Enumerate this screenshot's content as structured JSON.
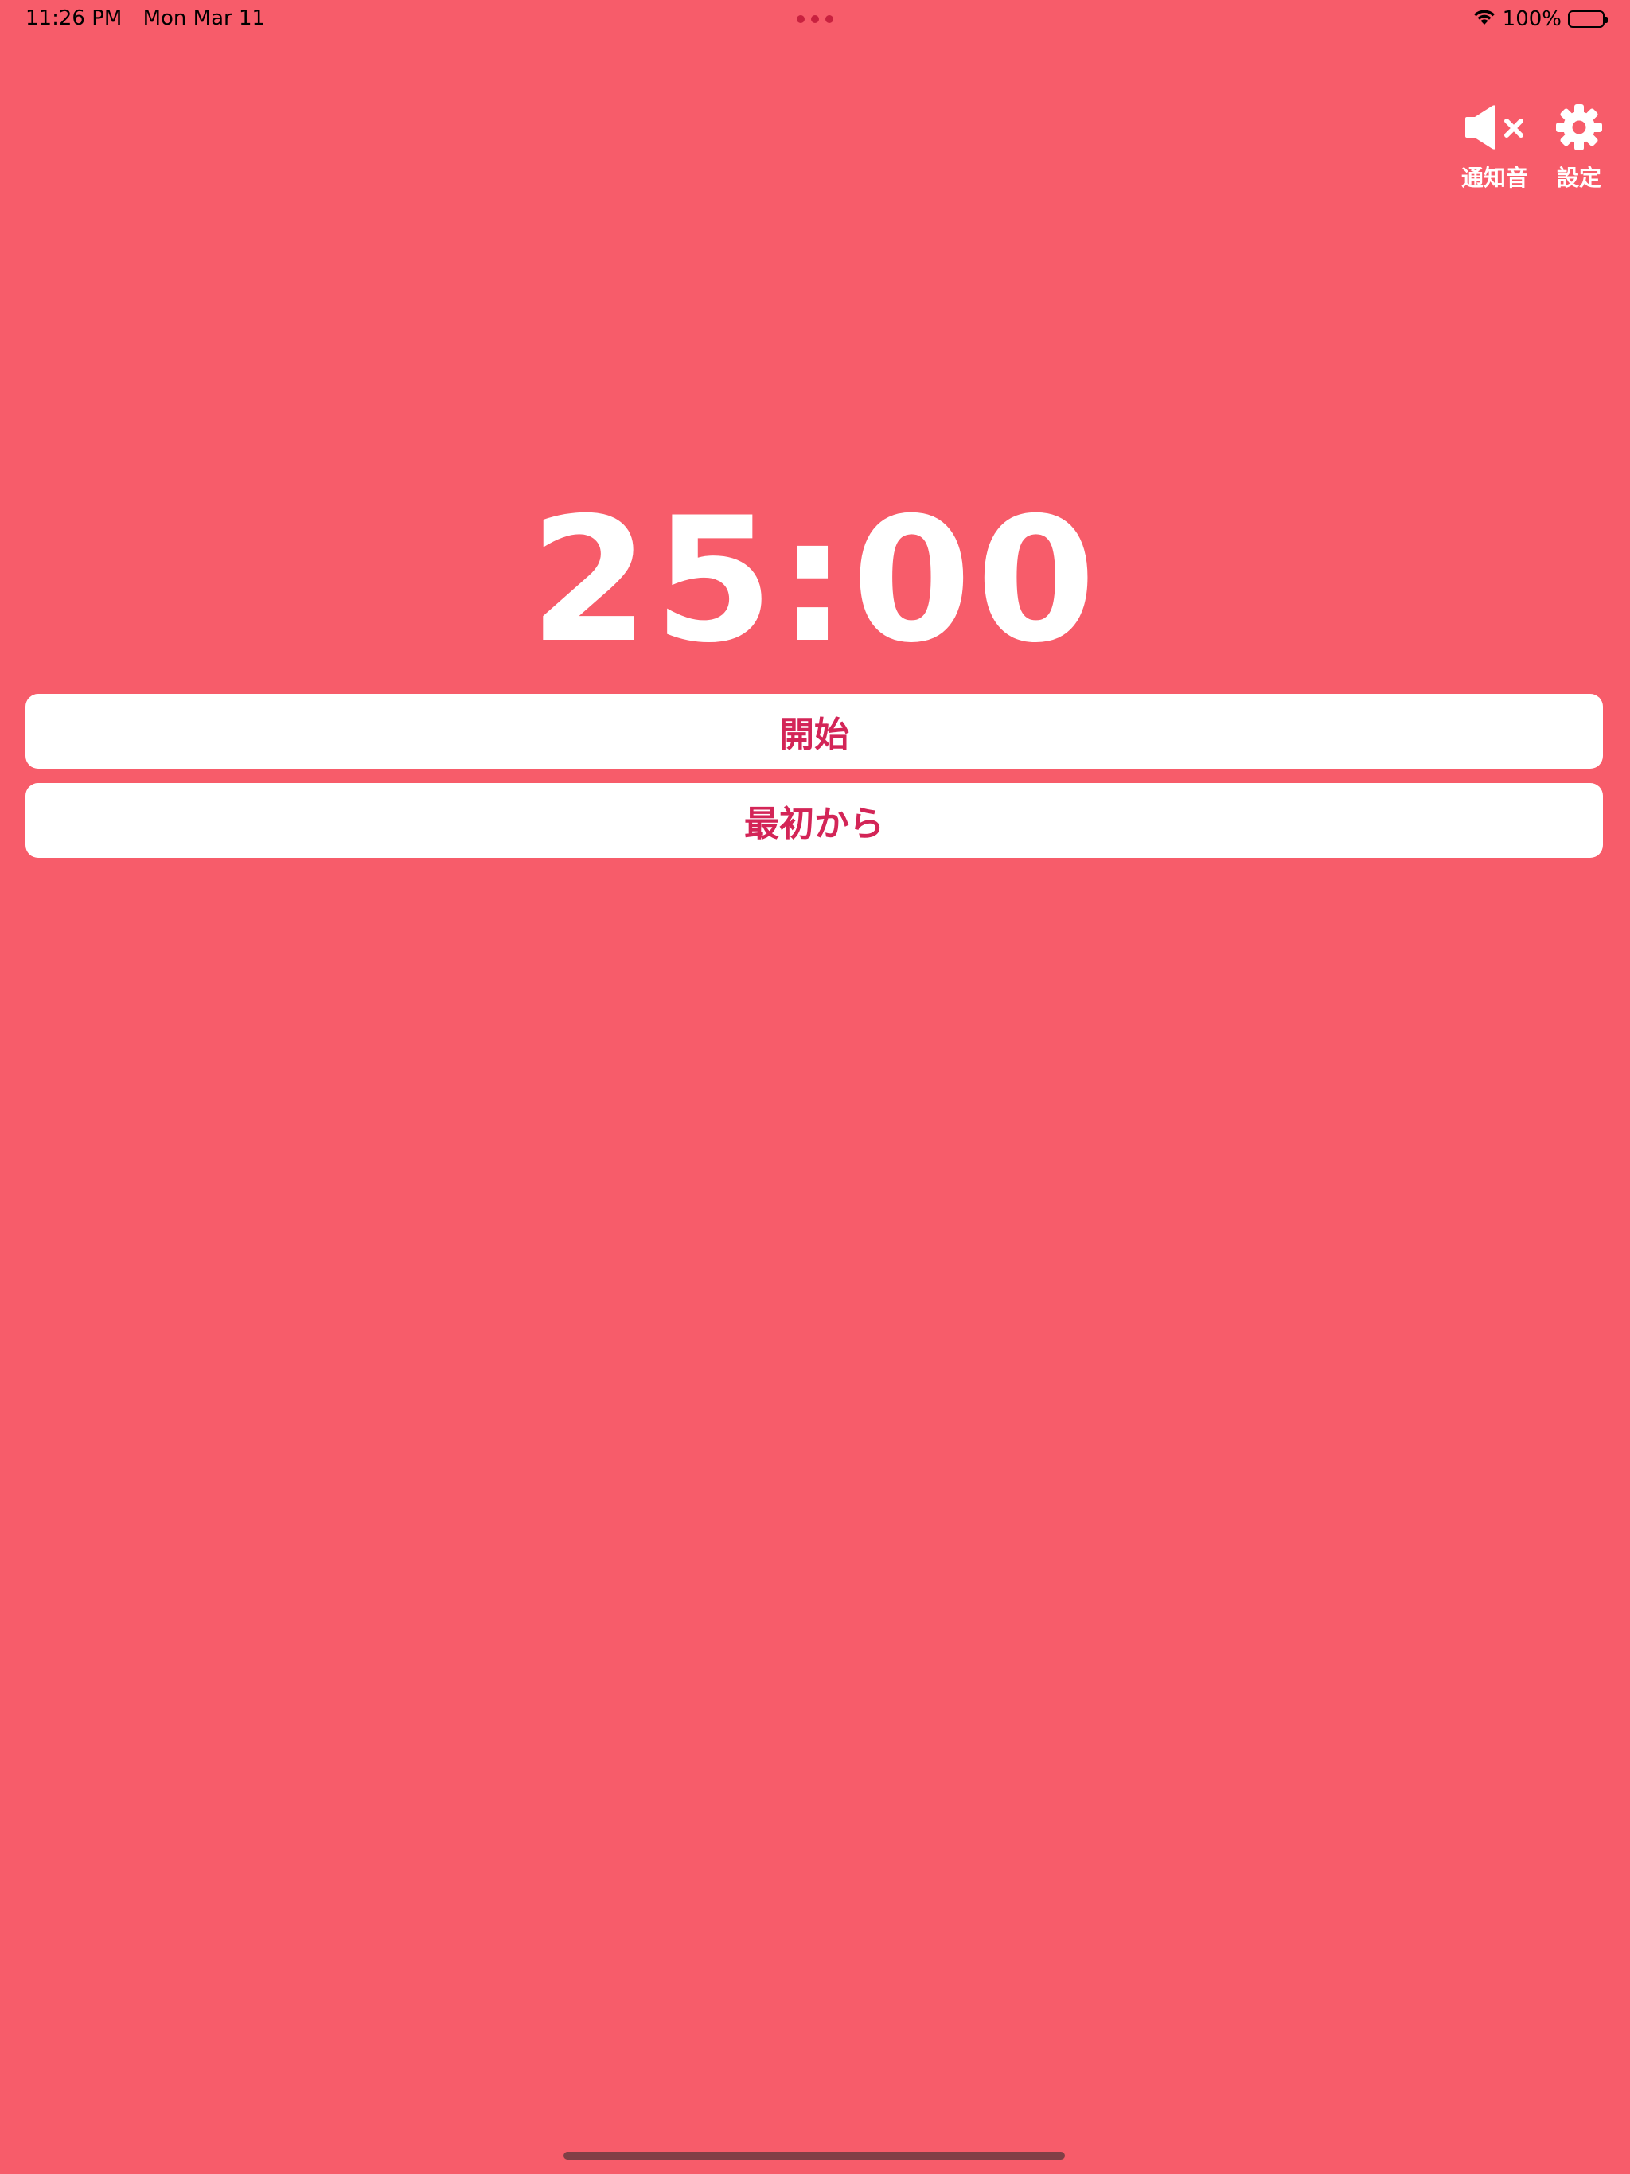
{
  "status_bar": {
    "time": "11:26 PM",
    "date": "Mon Mar 11",
    "battery_percent": "100%",
    "battery_level": 1.0,
    "wifi_icon": "wifi-icon",
    "battery_icon": "battery-full-icon"
  },
  "controls": {
    "sound": {
      "label": "通知音",
      "icon": "speaker-muted-icon"
    },
    "settings": {
      "label": "設定",
      "icon": "gear-icon"
    }
  },
  "timer": {
    "display": "25:00"
  },
  "buttons": {
    "start_label": "開始",
    "reset_label": "最初から"
  },
  "colors": {
    "background": "#F75C6A",
    "button_background": "#FFFFFF",
    "button_text": "#D32557",
    "timer_text": "#FFFFFF"
  }
}
